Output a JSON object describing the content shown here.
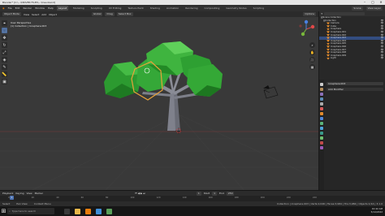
{
  "window": {
    "title": "Blender* [C:\\...\\DRIVER FILES\\...\\tree.blend]"
  },
  "menubar": {
    "items": [
      "File",
      "Edit",
      "Render",
      "Window",
      "Help"
    ],
    "workspaces": [
      "Layout",
      "Modeling",
      "Sculpting",
      "UV Editing",
      "Texture Paint",
      "Shading",
      "Animation",
      "Rendering",
      "Compositing",
      "Geometry Nodes",
      "Scripting"
    ],
    "scene": "Scene",
    "view_layer": "View Layer"
  },
  "header3d": {
    "mode": "Object Mode",
    "view": "View",
    "select": "Select",
    "add": "Add",
    "object": "Object",
    "orientation": "Global",
    "pivot": "Default",
    "drag": "Drag",
    "select_box": "Select Box",
    "options": "Options"
  },
  "viewport": {
    "perspective": "User Perspective",
    "collection": "(1) Collection | Icosphere.003"
  },
  "toolbar": {
    "icons": [
      "cursor-icon",
      "move-icon",
      "rotate-icon",
      "scale-icon",
      "transform-icon",
      "annotate-icon",
      "measure-icon",
      "add-cube-icon"
    ]
  },
  "outliner": {
    "search_placeholder": "",
    "rows": [
      {
        "label": "Scene Collection",
        "type": "collection"
      },
      {
        "label": "Collection",
        "type": "collection"
      },
      {
        "label": "Camera",
        "type": "object"
      },
      {
        "label": "Cube",
        "type": "object"
      },
      {
        "label": "Icosphere",
        "type": "object"
      },
      {
        "label": "Icosphere.001",
        "type": "object"
      },
      {
        "label": "Icosphere.002",
        "type": "object"
      },
      {
        "label": "Icosphere.003",
        "type": "object",
        "selected": true
      },
      {
        "label": "Icosphere.004",
        "type": "object"
      },
      {
        "label": "Icosphere.005",
        "type": "object"
      },
      {
        "label": "Icosphere.006",
        "type": "object"
      },
      {
        "label": "Icosphere.007",
        "type": "object"
      },
      {
        "label": "Icosphere.008",
        "type": "object"
      },
      {
        "label": "Icosphere.009",
        "type": "object"
      },
      {
        "label": "Light",
        "type": "object"
      }
    ]
  },
  "properties": {
    "object_name": "Icosphere.003",
    "modifier_label": "Add Modifier"
  },
  "timeline": {
    "menus": [
      "Playback",
      "Keying",
      "View",
      "Marker"
    ],
    "current_frame": "1",
    "ruler": [
      "0",
      "20",
      "40",
      "60",
      "80",
      "100",
      "120",
      "140",
      "160",
      "180",
      "200",
      "220",
      "240"
    ],
    "start_label": "Start",
    "start": "1",
    "end_label": "End",
    "end": "250"
  },
  "statusbar": {
    "select": "Select",
    "pan": "Pan View",
    "context": "Context Menu",
    "stats": "Collection | Icosphere.003 | Verts:2,046 | Faces:3,984 | Tris:3,984 | Objects:1/14 | 3.1.0"
  },
  "taskbar": {
    "search_placeholder": "Type here to search",
    "time": "10:42 AM",
    "date": "5/14/2022"
  },
  "colors": {
    "foliage": "#3aa83a",
    "foliage_dark": "#207a24",
    "trunk": "#8a8c96",
    "selection": "#e8a23a",
    "viewport_bg": "#393939"
  }
}
